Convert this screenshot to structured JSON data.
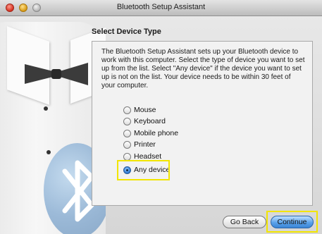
{
  "window": {
    "title": "Bluetooth Setup Assistant"
  },
  "page": {
    "heading": "Select Device Type",
    "description": "The Bluetooth Setup Assistant sets up your Bluetooth device to work with this computer. Select the type of device you want to set up from the list. Select \"Any device\" if the device you want to set up is not on the list. Your device needs to be within 30 feet of your computer."
  },
  "device_types": {
    "options": [
      {
        "label": "Mouse",
        "selected": false
      },
      {
        "label": "Keyboard",
        "selected": false
      },
      {
        "label": "Mobile phone",
        "selected": false
      },
      {
        "label": "Printer",
        "selected": false
      },
      {
        "label": "Headset",
        "selected": false
      },
      {
        "label": "Any device",
        "selected": true
      }
    ]
  },
  "buttons": {
    "go_back": "Go Back",
    "continue": "Continue"
  },
  "colors": {
    "highlight": "#f2e500",
    "accent": "#3a85d6"
  },
  "icons": {
    "art": "bluetooth-icon"
  }
}
